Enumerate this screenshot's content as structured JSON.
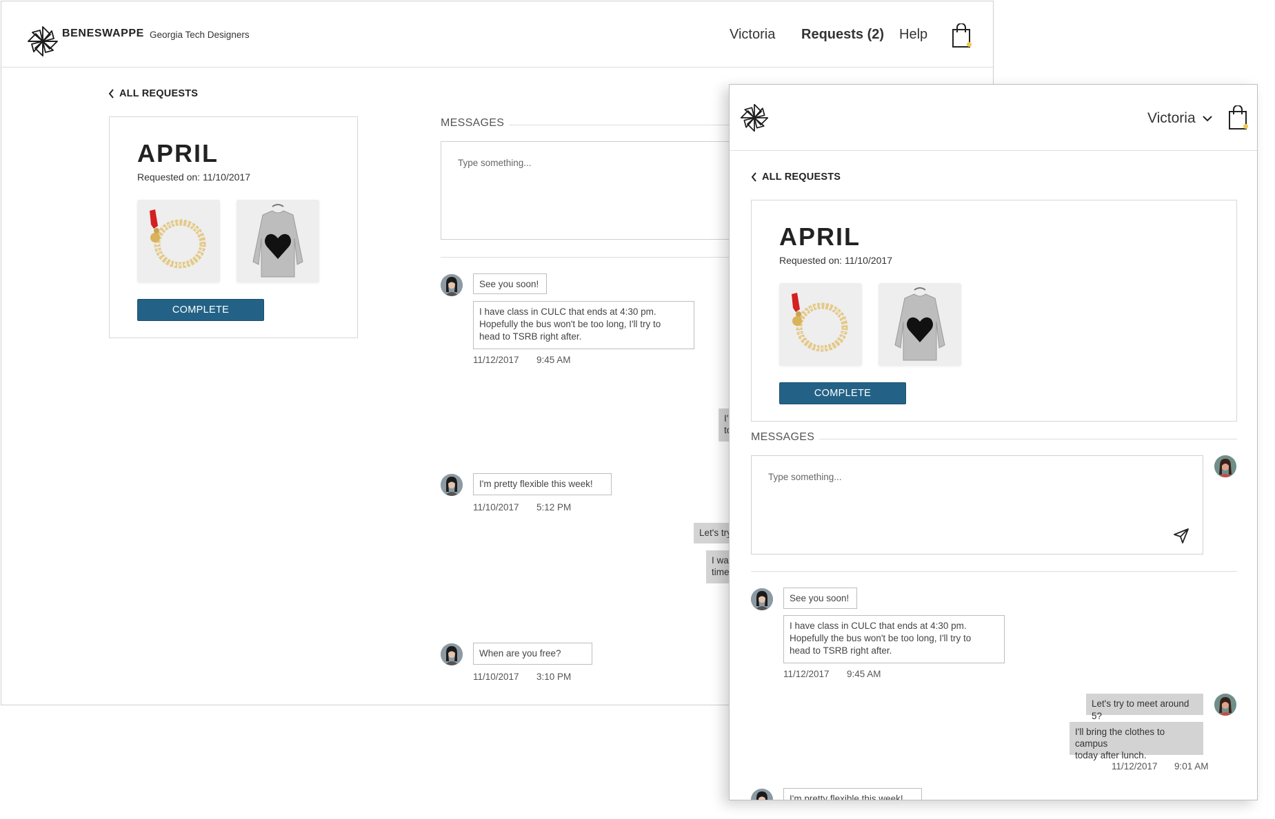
{
  "brand": {
    "name": "BENESWAPPE",
    "org": "Georgia Tech Designers"
  },
  "nav": {
    "user": "Victoria",
    "requests": "Requests (2)",
    "help": "Help"
  },
  "back_link": "ALL REQUESTS",
  "request": {
    "name": "APRIL",
    "date": "Requested on: 11/10/2017",
    "items": [
      "bracelet-thumbnail",
      "heart-sweater-thumbnail"
    ],
    "complete_label": "COMPLETE"
  },
  "messages": {
    "title": "MESSAGES",
    "placeholder": "Type something...",
    "desktop_thread": [
      {
        "from": "them",
        "lines": [
          "See you soon!"
        ]
      },
      {
        "from": "them",
        "lines": [
          "I have class in CULC that ends at 4:30 pm.",
          "Hopefully the bus won't be too long, I'll try to",
          "head to TSRB right after."
        ]
      },
      {
        "meta_date": "11/12/2017",
        "meta_time": "9:45 AM"
      },
      {
        "from": "me",
        "lines": [
          "I'",
          "to"
        ]
      },
      {
        "from": "them",
        "lines": [
          "I'm pretty flexible this week!"
        ]
      },
      {
        "meta_date": "11/10/2017",
        "meta_time": "5:12 PM"
      },
      {
        "from": "me",
        "lines": [
          "Let's try"
        ]
      },
      {
        "from": "me",
        "lines": [
          "I war",
          "time"
        ]
      },
      {
        "from": "them",
        "lines": [
          "When are you free?"
        ]
      },
      {
        "meta_date": "11/10/2017",
        "meta_time": "3:10 PM"
      }
    ],
    "mobile_thread": {
      "msg1": "See you soon!",
      "msg2": [
        "I have class in CULC that ends at 4:30 pm.",
        "Hopefully the bus won't be too long, I'll try to",
        "head to TSRB right after."
      ],
      "meta1_date": "11/12/2017",
      "meta1_time": "9:45 AM",
      "out1": "Let's try to meet around 5?",
      "out2": [
        "I'll bring the clothes to campus",
        "today after lunch."
      ],
      "meta2_date": "11/12/2017",
      "meta2_time": "9:01 AM",
      "msg3": "I'm pretty flexible this week!"
    }
  },
  "colors": {
    "primary": "#236286",
    "cart_dot": "#f2c94c",
    "outgoing_bubble": "#d3d3d3"
  }
}
